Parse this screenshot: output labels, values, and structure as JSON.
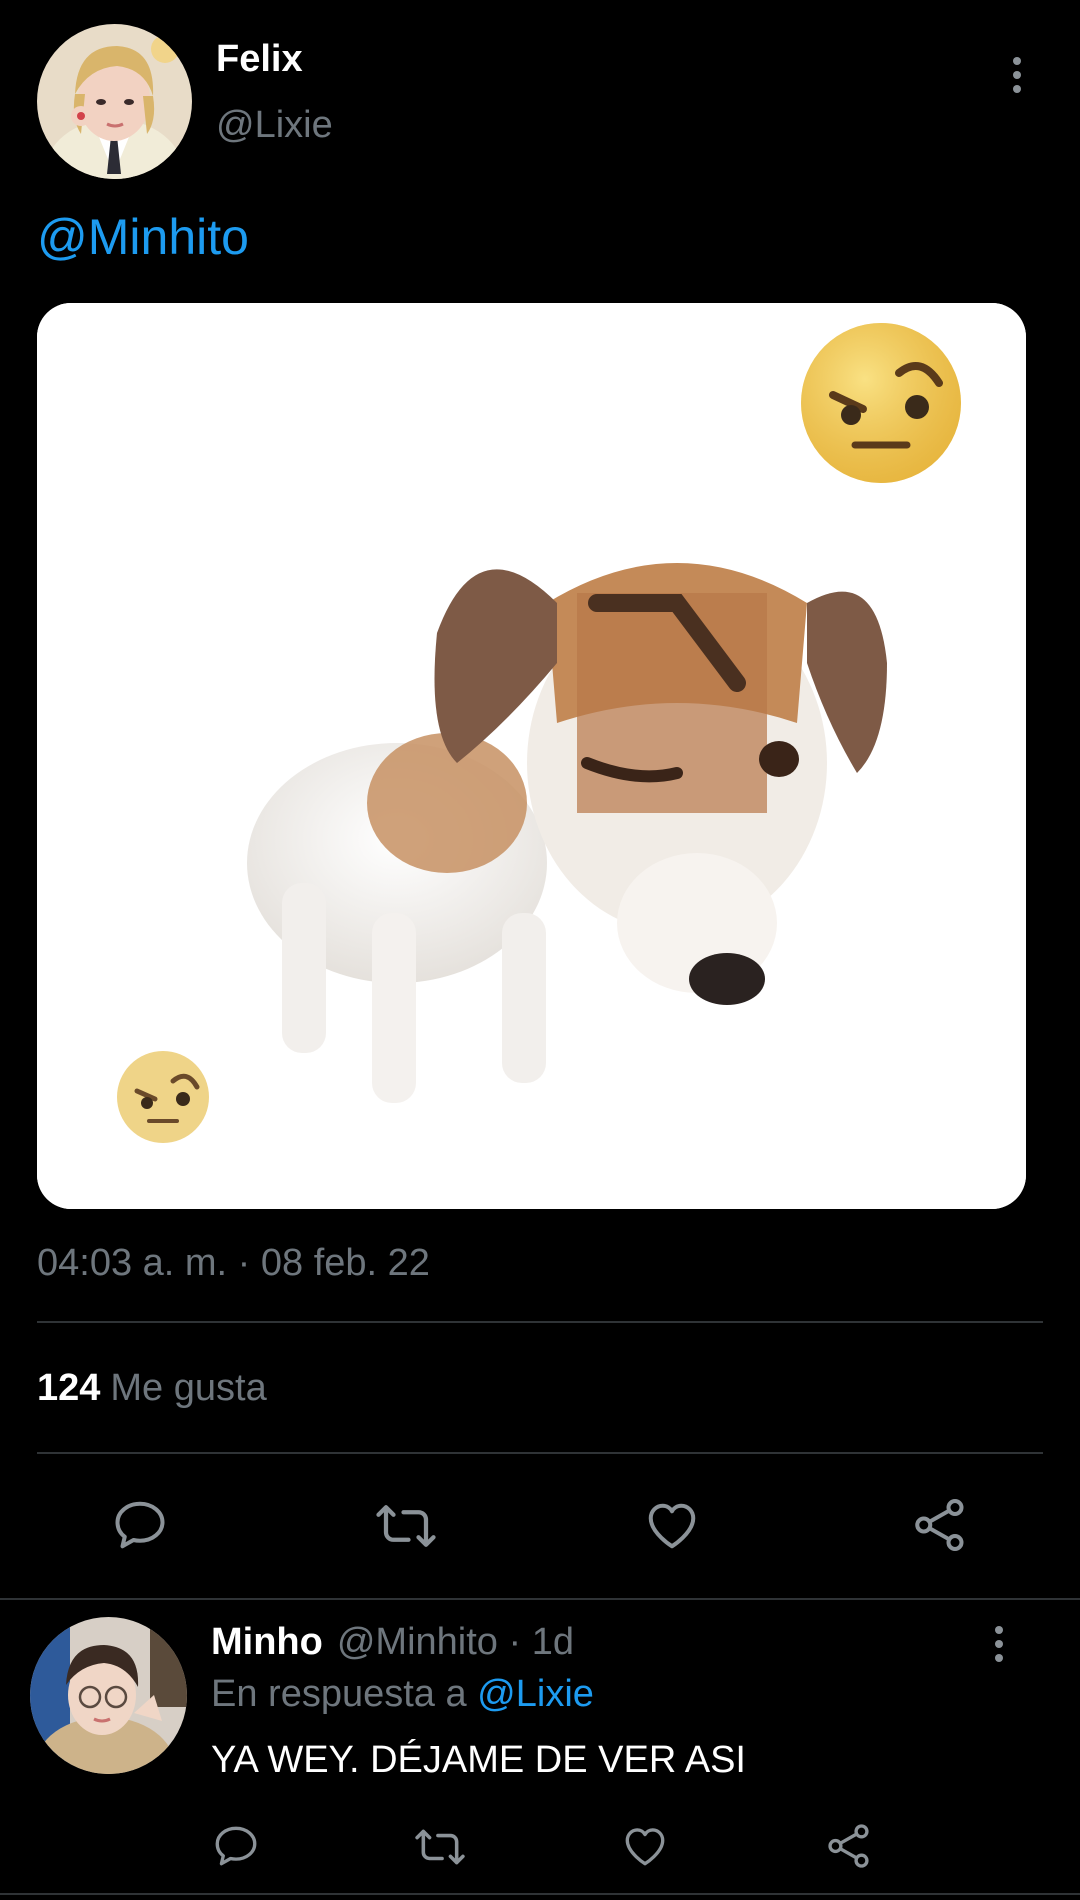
{
  "colors": {
    "background": "#000000",
    "accent": "#1d9bf0",
    "muted_text": "#6e767d",
    "divider": "#2f3336",
    "icon": "#8b9298"
  },
  "tweet": {
    "author_name": "Felix",
    "author_handle": "@Lixie",
    "text_mention": "@Minhito",
    "media_description_icon": "dog-meme-image",
    "timestamp": "04:03 a. m. · 08 feb. 22",
    "likes_count": "124",
    "likes_label": "Me gusta",
    "actions": [
      {
        "name": "reply",
        "icon": "comment-icon"
      },
      {
        "name": "retweet",
        "icon": "retweet-icon"
      },
      {
        "name": "like",
        "icon": "heart-icon"
      },
      {
        "name": "share",
        "icon": "share-icon"
      }
    ]
  },
  "reply": {
    "author_name": "Minho",
    "author_handle": "@Minhito · 1d",
    "replying_to_prefix": "En respuesta a",
    "replying_to_handle": "@Lixie",
    "text": "YA WEY. DÉJAME DE VER ASI"
  }
}
